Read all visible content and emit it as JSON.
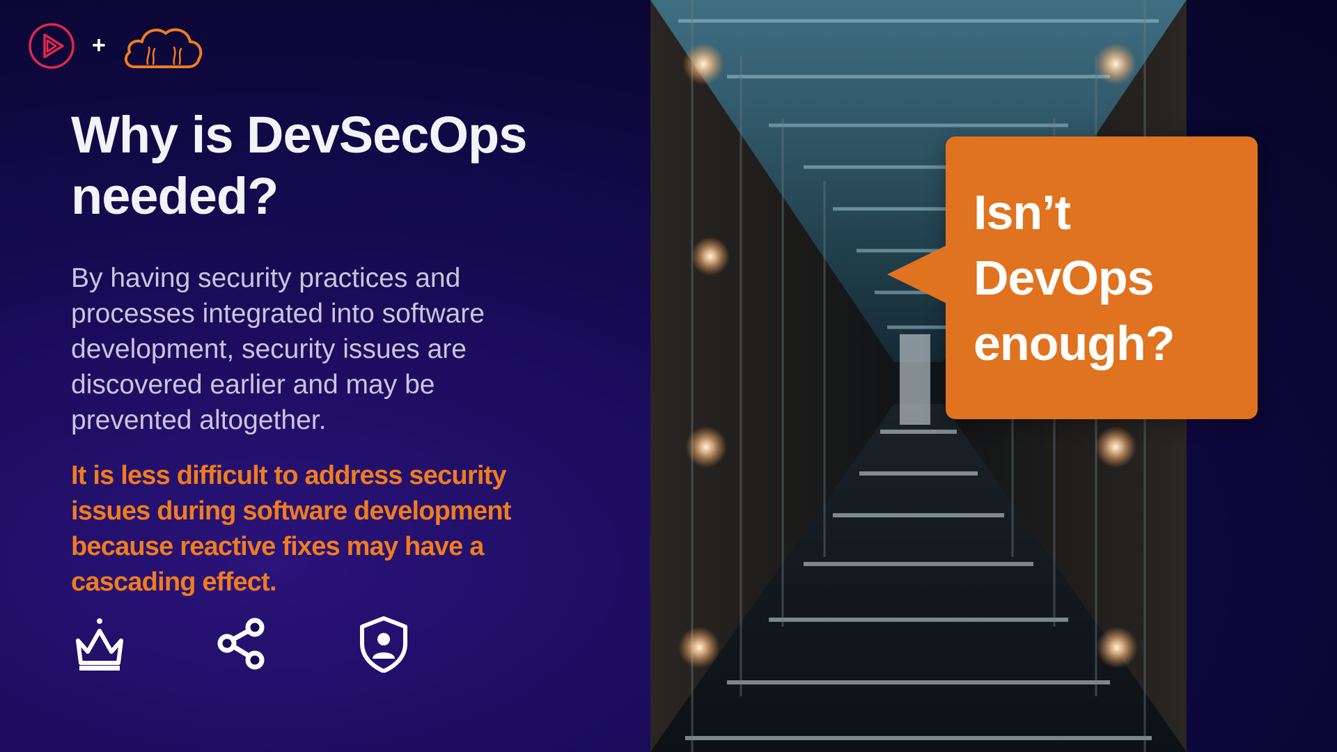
{
  "slide": {
    "logos": {
      "left_icon": "play-logo-icon",
      "separator": "+",
      "right_icon": "cloud-logo-icon"
    },
    "title": "Why is DevSecOps needed?",
    "body": "By having security practices and processes integrated into software development, security issues are discovered earlier and may be prevented altogether.",
    "highlight": "It is less difficult to address security issues during software development because reactive fixes may have a cascading effect.",
    "icons": [
      "crown-icon",
      "share-icon",
      "shield-user-icon"
    ],
    "callout": "Isn’t DevOps enough?",
    "photo": "server-corridor-photo"
  },
  "colors": {
    "background": "#170b55",
    "accent": "#f07c1f",
    "callout_bg": "#e0731f",
    "logo_red": "#e0284a",
    "title": "#f3f2f8",
    "body": "#c9c6dc"
  }
}
